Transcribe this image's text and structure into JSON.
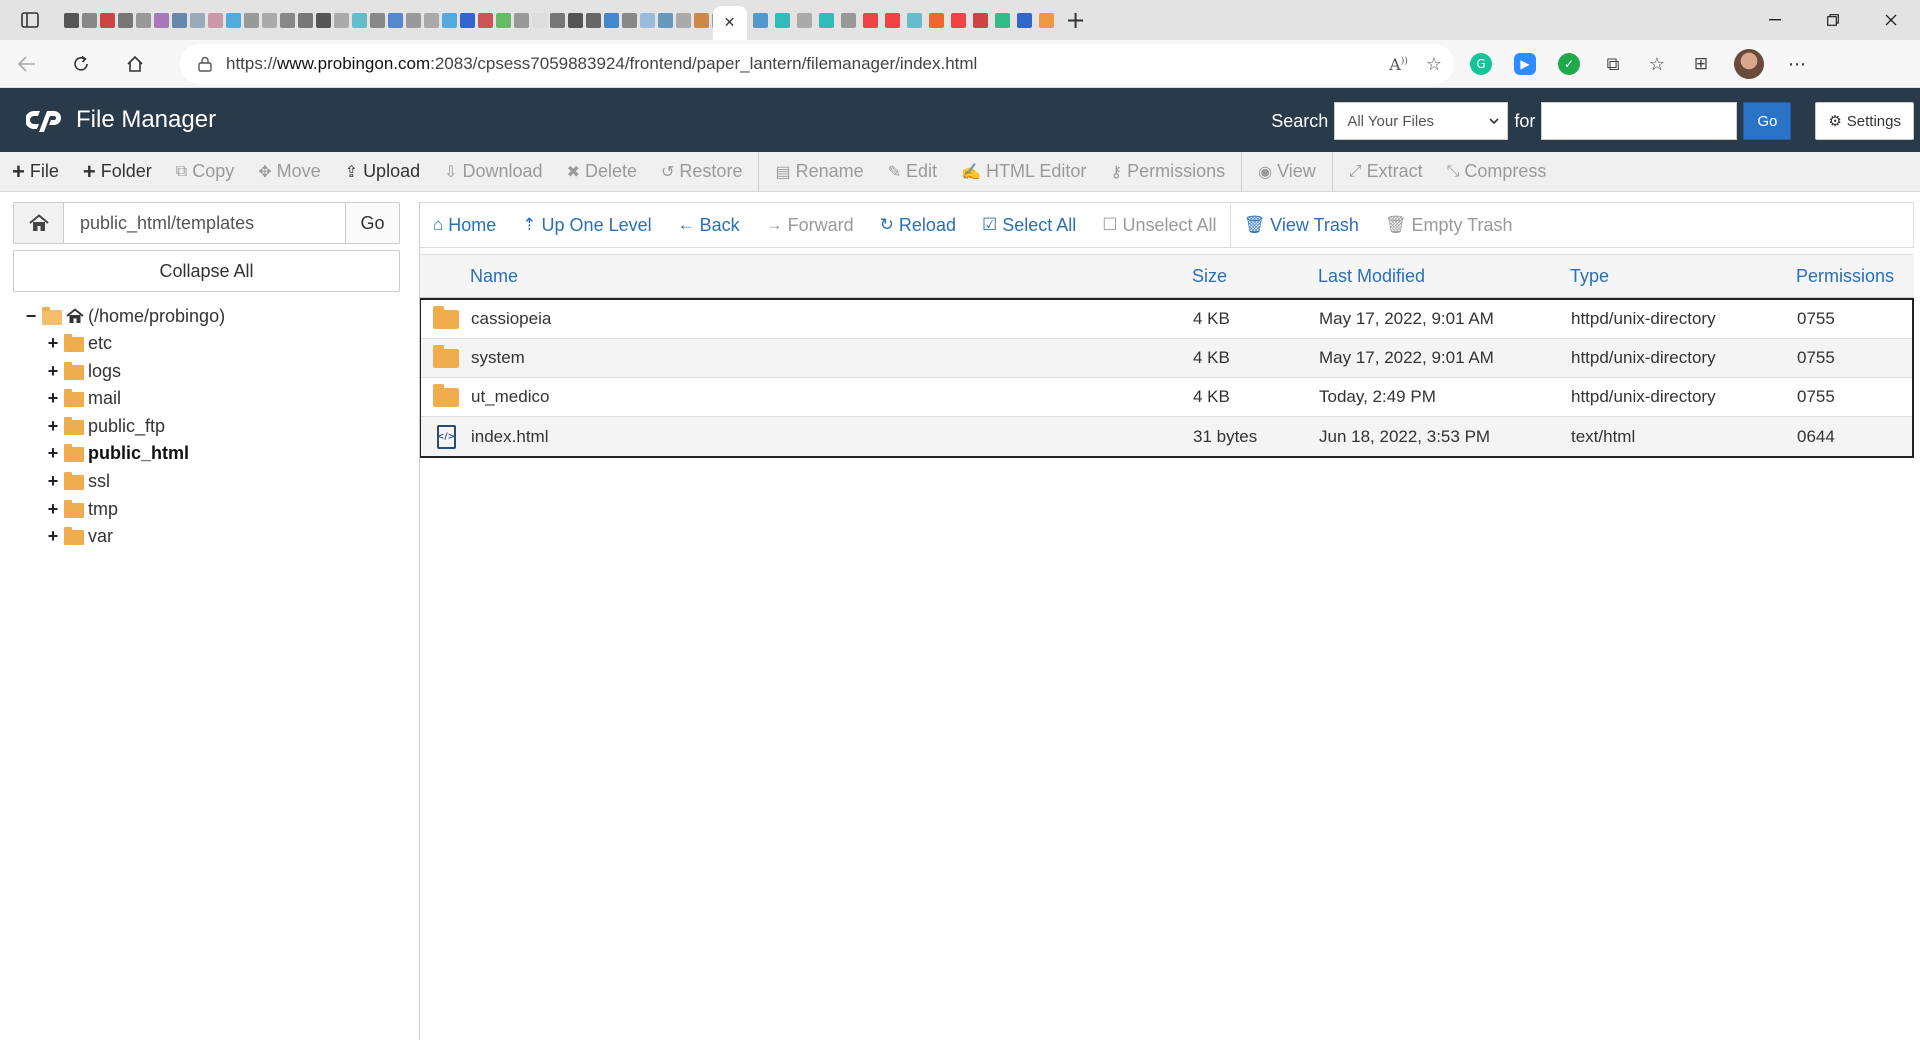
{
  "browser": {
    "url_prefix": "https://",
    "url_host": "www.probingon.com",
    "url_rest": ":2083/cpsess7059883924/frontend/paper_lantern/filemanager/index.html",
    "new_tab_glyph": "+",
    "tab_close_glyph": "✕",
    "tab_favicon_colors": [
      "#555",
      "#888",
      "#c44",
      "#777",
      "#999",
      "#a7b",
      "#68a",
      "#9ab",
      "#c9a",
      "#5ad",
      "#999",
      "#aaa",
      "#888",
      "#777",
      "#555",
      "#aaa",
      "#6bc",
      "#888",
      "#58c",
      "#999",
      "#aaa",
      "#5ad",
      "#36c",
      "#c55",
      "#6b6",
      "#999",
      "#ddd",
      "#777",
      "#555",
      "#666",
      "#48c",
      "#888",
      "#9bd",
      "#69b",
      "#aaa",
      "#c84",
      "#999",
      "#6a6",
      "#888",
      "#56b",
      "#e11",
      "#888",
      "#aaa",
      "#777",
      "#888",
      "#5ad",
      "#999",
      "#666",
      "#49c",
      "#c55",
      "#888",
      "#aaa",
      "#777",
      "#666",
      "#999",
      "#aaa",
      "#888",
      "#777",
      "#999",
      "#666",
      "#aaa",
      "#5ad",
      "#888",
      "#777",
      "#999",
      "#9bd",
      "#aaa",
      "#777",
      "#888",
      "#58c",
      "#c55",
      "#aaa",
      "#888",
      "#777",
      "#555",
      "#999",
      "#888",
      "#48c",
      "#6bc",
      "#222",
      "#3bb",
      "#e63"
    ],
    "tab_favicon_colors_after": [
      "#59c",
      "#3bb",
      "#aaa",
      "#3bb",
      "#999",
      "#e44",
      "#e44",
      "#6bc",
      "#e63",
      "#e44",
      "#c44",
      "#3b8",
      "#36c",
      "#e94"
    ]
  },
  "cp_header": {
    "title": "File Manager",
    "search_label": "Search",
    "search_scope": "All Your Files",
    "for_label": "for",
    "search_value": "",
    "go_label": "Go",
    "settings_label": "Settings"
  },
  "actions": [
    {
      "label": "File",
      "icon": "+",
      "name": "file",
      "disabled": false
    },
    {
      "label": "Folder",
      "icon": "+",
      "name": "folder",
      "disabled": false
    },
    {
      "label": "Copy",
      "icon": "⧉",
      "name": "copy",
      "disabled": true
    },
    {
      "label": "Move",
      "icon": "✥",
      "name": "move",
      "disabled": true
    },
    {
      "label": "Upload",
      "icon": "⇪",
      "name": "upload",
      "disabled": false
    },
    {
      "label": "Download",
      "icon": "⇩",
      "name": "download",
      "disabled": true
    },
    {
      "label": "Delete",
      "icon": "✖",
      "name": "delete",
      "disabled": true
    },
    {
      "label": "Restore",
      "icon": "↺",
      "name": "restore",
      "disabled": true
    },
    {
      "label": "Rename",
      "icon": "▤",
      "name": "rename",
      "disabled": true
    },
    {
      "label": "Edit",
      "icon": "✎",
      "name": "edit",
      "disabled": true
    },
    {
      "label": "HTML Editor",
      "icon": "✍",
      "name": "html-editor",
      "disabled": true
    },
    {
      "label": "Permissions",
      "icon": "⚷",
      "name": "permissions",
      "disabled": true
    },
    {
      "label": "View",
      "icon": "◉",
      "name": "view",
      "disabled": true
    },
    {
      "label": "Extract",
      "icon": "⤢",
      "name": "extract",
      "disabled": true
    },
    {
      "label": "Compress",
      "icon": "⤡",
      "name": "compress",
      "disabled": true
    }
  ],
  "left": {
    "path_value": "public_html/templates",
    "go_label": "Go",
    "collapse_label": "Collapse All",
    "root_label": "(/home/probingo)",
    "tree": [
      {
        "label": "etc",
        "bold": false
      },
      {
        "label": "logs",
        "bold": false
      },
      {
        "label": "mail",
        "bold": false
      },
      {
        "label": "public_ftp",
        "bold": false
      },
      {
        "label": "public_html",
        "bold": true
      },
      {
        "label": "ssl",
        "bold": false
      },
      {
        "label": "tmp",
        "bold": false
      },
      {
        "label": "var",
        "bold": false
      }
    ]
  },
  "nav": [
    {
      "label": "Home",
      "icon": "⌂",
      "name": "home",
      "disabled": false
    },
    {
      "label": "Up One Level",
      "icon": "⇡",
      "name": "up-one-level",
      "disabled": false
    },
    {
      "label": "Back",
      "icon": "←",
      "name": "back",
      "disabled": false
    },
    {
      "label": "Forward",
      "icon": "→",
      "name": "forward",
      "disabled": true
    },
    {
      "label": "Reload",
      "icon": "↻",
      "name": "reload",
      "disabled": false
    },
    {
      "label": "Select All",
      "icon": "☑",
      "name": "select-all",
      "disabled": false
    },
    {
      "label": "Unselect All",
      "icon": "☐",
      "name": "unselect-all",
      "disabled": true
    },
    {
      "label": "View Trash",
      "icon": "🗑",
      "name": "view-trash",
      "disabled": false
    },
    {
      "label": "Empty Trash",
      "icon": "🗑",
      "name": "empty-trash",
      "disabled": true
    }
  ],
  "table": {
    "columns": [
      "Name",
      "Size",
      "Last Modified",
      "Type",
      "Permissions"
    ],
    "rows": [
      {
        "kind": "folder",
        "name": "cassiopeia",
        "size": "4 KB",
        "modified": "May 17, 2022, 9:01 AM",
        "type": "httpd/unix-directory",
        "perms": "0755"
      },
      {
        "kind": "folder",
        "name": "system",
        "size": "4 KB",
        "modified": "May 17, 2022, 9:01 AM",
        "type": "httpd/unix-directory",
        "perms": "0755"
      },
      {
        "kind": "folder",
        "name": "ut_medico",
        "size": "4 KB",
        "modified": "Today, 2:49 PM",
        "type": "httpd/unix-directory",
        "perms": "0755"
      },
      {
        "kind": "file",
        "name": "index.html",
        "size": "31 bytes",
        "modified": "Jun 18, 2022, 3:53 PM",
        "type": "text/html",
        "perms": "0644"
      }
    ]
  }
}
